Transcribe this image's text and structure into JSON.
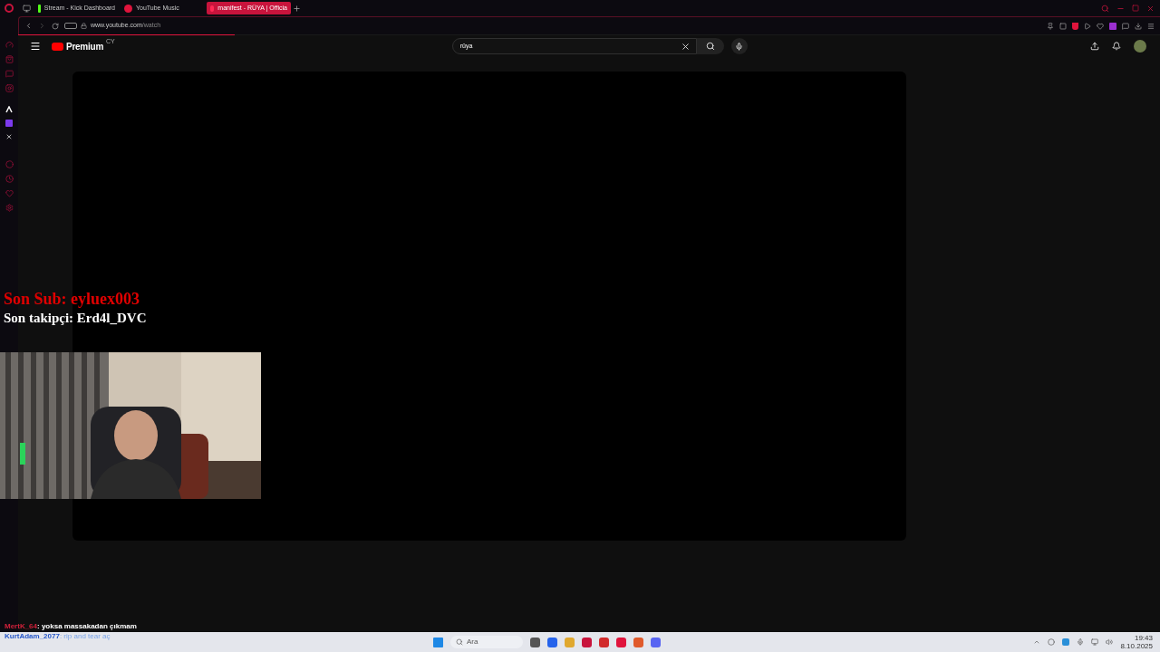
{
  "browser": {
    "tabs": [
      {
        "label": "Stream - Kick Dashboard",
        "kind": "kick",
        "selected": false
      },
      {
        "label": "YouTube Music",
        "kind": "music",
        "selected": false
      },
      {
        "label": "manifest - RÜYA | Officia",
        "kind": "youtube",
        "selected": true
      }
    ],
    "url_host": "www.youtube.com",
    "url_path": "/watch",
    "load": {
      "level": 0.19
    }
  },
  "youtube": {
    "logo": "Premium",
    "country": "CY",
    "search": "rüya"
  },
  "overlay": {
    "last_sub": "Son Sub: eyluex003",
    "last_follower": "Son takipçi: Erd4l_DVC"
  },
  "chat": [
    {
      "user": "MertK_64",
      "message": ": yoksa massakadan çıkmam",
      "color": "#d0213a"
    },
    {
      "user": "KurtAdam_2077",
      "message": ": rip and tear aç",
      "color": "#2456c8"
    }
  ],
  "taskbar": {
    "search_placeholder": "Ara",
    "time": "19:43",
    "date": "8.10.2025"
  }
}
